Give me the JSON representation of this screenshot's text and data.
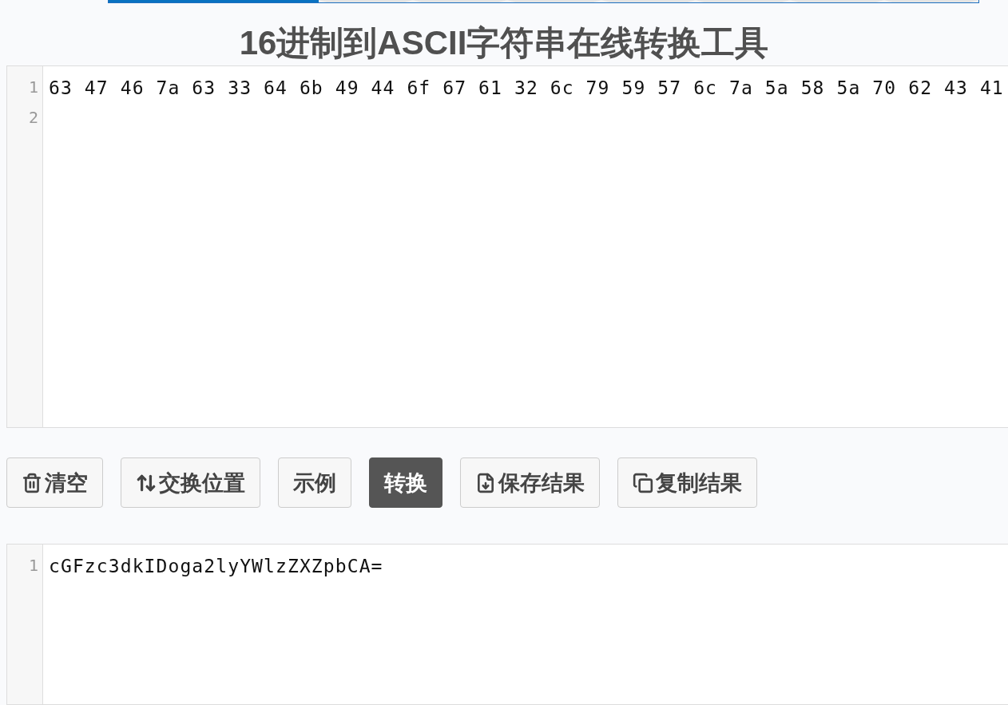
{
  "title": "16进制到ASCII字符串在线转换工具",
  "input_editor": {
    "line_numbers": [
      "1",
      "2"
    ],
    "lines": [
      "63 47 46 7a 63 33 64 6b 49 44 6f 67 61 32 6c 79 59 57 6c 7a 5a 58 5a 70 62 43 41"
    ]
  },
  "buttons": [
    {
      "label": "清空",
      "kind": "default"
    },
    {
      "label": "交换位置",
      "kind": "default"
    },
    {
      "label": "示例",
      "kind": "default"
    },
    {
      "label": "转换",
      "kind": "primary"
    },
    {
      "label": "保存结果",
      "kind": "default"
    },
    {
      "label": "复制结果",
      "kind": "default"
    }
  ],
  "output_editor": {
    "line_numbers": [
      "1"
    ],
    "lines": [
      "cGFzc3dkIDoga2lyYWlzZXZpbCA="
    ]
  }
}
